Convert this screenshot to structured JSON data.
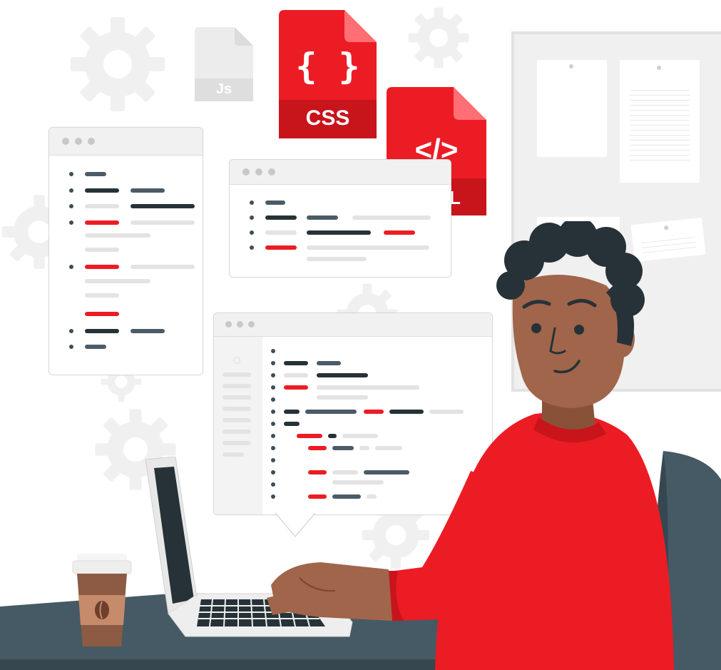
{
  "files": {
    "js": {
      "label": "Js"
    },
    "css": {
      "label": "CSS",
      "glyph": "{ }"
    },
    "html": {
      "label": "HTML",
      "visible_label": "L",
      "glyph": "</>"
    }
  },
  "icons": {
    "gear": "gear-icon",
    "coffee": "coffee-cup-icon",
    "laptop": "laptop-icon"
  },
  "colors": {
    "accent": "#ec1c24",
    "accent_dark": "#c8141b",
    "dark": "#263238",
    "skin": "#a0654a",
    "gear": "#f1f1f1"
  }
}
